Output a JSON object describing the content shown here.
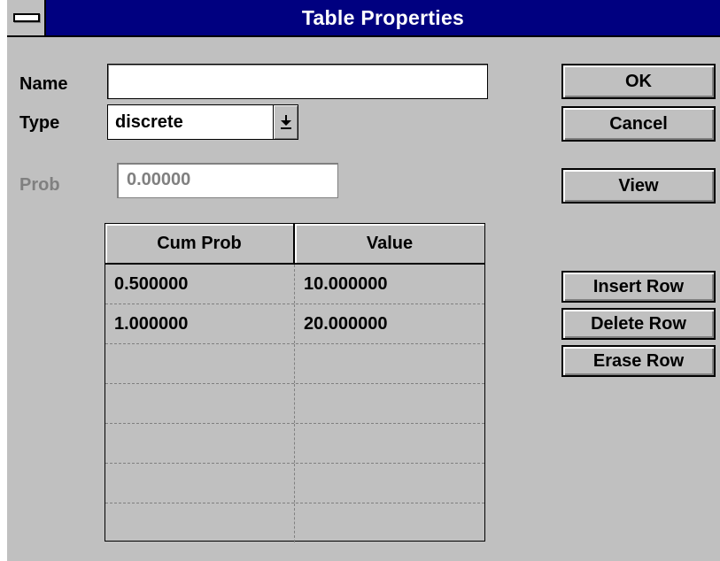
{
  "window": {
    "title": "Table Properties"
  },
  "form": {
    "name_label": "Name",
    "name_value": "",
    "type_label": "Type",
    "type_value": "discrete",
    "prob_label": "Prob",
    "prob_value": "0.00000"
  },
  "table": {
    "columns": [
      "Cum Prob",
      "Value"
    ],
    "rows": [
      [
        "0.500000",
        "10.000000"
      ],
      [
        "1.000000",
        "20.000000"
      ],
      [
        "",
        ""
      ],
      [
        "",
        ""
      ],
      [
        "",
        ""
      ],
      [
        "",
        ""
      ],
      [
        "",
        ""
      ]
    ]
  },
  "buttons": {
    "ok": "OK",
    "cancel": "Cancel",
    "view": "View",
    "insert_row": "Insert Row",
    "delete_row": "Delete Row",
    "erase_row": "Erase Row"
  },
  "icons": {
    "system_menu": "system-menu-icon",
    "dropdown": "dropdown-arrow-icon"
  },
  "colors": {
    "titlebar": "#000080",
    "face": "#c0c0c0",
    "disabled_text": "#808080"
  }
}
